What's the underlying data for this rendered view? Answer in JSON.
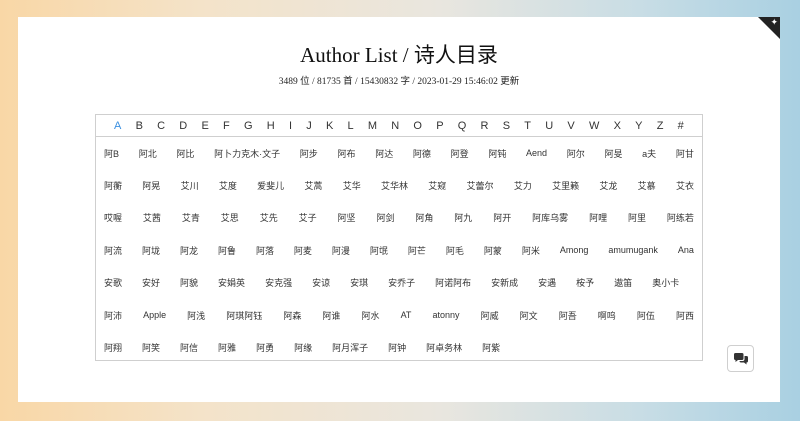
{
  "page": {
    "title": "Author List / 诗人目录",
    "stats": "3489 位 / 81735 首 / 15430832 字 / 2023-01-29 15:46:02 更新"
  },
  "letters": [
    "A",
    "B",
    "C",
    "D",
    "E",
    "F",
    "G",
    "H",
    "I",
    "J",
    "K",
    "L",
    "M",
    "N",
    "O",
    "P",
    "Q",
    "R",
    "S",
    "T",
    "U",
    "V",
    "W",
    "X",
    "Y",
    "Z",
    "#"
  ],
  "active_letter": "A",
  "authors": [
    [
      "阿B",
      "阿北",
      "阿比",
      "阿卜力克木·文子",
      "阿步",
      "阿布",
      "阿达",
      "阿德",
      "阿登",
      "阿钝",
      "Aend",
      "阿尔",
      "阿旻",
      "a夫",
      "阿甘"
    ],
    [
      "阿蘅",
      "阿晃",
      "艾川",
      "艾度",
      "爱斐儿",
      "艾蒿",
      "艾华",
      "艾华林",
      "艾窥",
      "艾蕾尔",
      "艾力",
      "艾里籁",
      "艾龙",
      "艾慕",
      "艾衣"
    ],
    [
      "哎喔",
      "艾茜",
      "艾青",
      "艾思",
      "艾先",
      "艾子",
      "阿坚",
      "阿剑",
      "阿角",
      "阿九",
      "阿开",
      "阿库乌雾",
      "阿哩",
      "阿里",
      "阿练若"
    ],
    [
      "阿流",
      "阿垅",
      "阿龙",
      "阿鲁",
      "阿落",
      "阿麦",
      "阿漫",
      "阿氓",
      "阿芒",
      "阿毛",
      "阿蒙",
      "阿米",
      "Among",
      "amumugank",
      "Ana"
    ],
    [
      "安歌",
      "安好",
      "阿貌",
      "安娟英",
      "安克强",
      "安谅",
      "安琪",
      "安乔子",
      "阿诺阿布",
      "安新成",
      "安遇",
      "桉予",
      "遨笛",
      "奥小卡"
    ],
    [
      "阿沛",
      "Apple",
      "阿浅",
      "阿琪阿钰",
      "阿森",
      "阿谁",
      "阿水",
      "AT",
      "atonny",
      "阿威",
      "阿文",
      "阿吾",
      "啊呜",
      "阿伍",
      "阿西"
    ],
    [
      "阿翔",
      "阿笑",
      "阿信",
      "阿雅",
      "阿勇",
      "阿缘",
      "阿月浑子",
      "阿钟",
      "阿卓务林",
      "阿紫"
    ]
  ],
  "icons": {
    "corner": "star-icon",
    "fab": "chat-bubbles-icon"
  },
  "colors": {
    "active_letter": "#3a8fe0",
    "corner": "#222222"
  }
}
